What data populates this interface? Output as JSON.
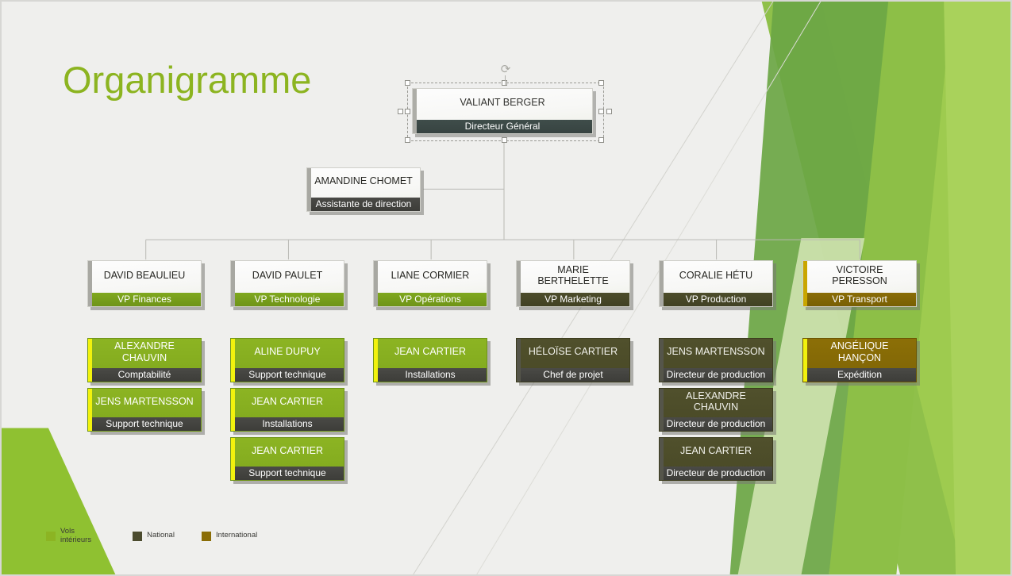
{
  "slide": {
    "title": "Organigramme",
    "title_color": "#8cb420",
    "background_color": "#efefed"
  },
  "chart_data": {
    "type": "diagram",
    "diagram_type": "organization-chart",
    "title": "Organigramme",
    "root": {
      "name": "VALIANT BERGER",
      "role": "Directeur Général",
      "style": "light",
      "selected": true
    },
    "assistant": {
      "name": "AMANDINE CHOMET",
      "role": "Assistante de direction",
      "style": "light"
    },
    "columns": [
      {
        "head": {
          "name": "DAVID BEAULIEU",
          "role": "VP Finances",
          "style": "light",
          "bar": "green",
          "edge": "grey"
        },
        "reports": [
          {
            "name": "ALEXANDRE CHAUVIN",
            "role": "Comptabilité",
            "style": "green",
            "bar": "dark",
            "edge": "yellow"
          },
          {
            "name": "JENS MARTENSSON",
            "role": "Support technique",
            "style": "green",
            "bar": "dark",
            "edge": "yellow"
          }
        ]
      },
      {
        "head": {
          "name": "DAVID PAULET",
          "role": "VP Technologie",
          "style": "light",
          "bar": "green",
          "edge": "grey"
        },
        "reports": [
          {
            "name": "ALINE DUPUY",
            "role": "Support technique",
            "style": "green",
            "bar": "dark",
            "edge": "yellow"
          },
          {
            "name": "JEAN CARTIER",
            "role": "Installations",
            "style": "green",
            "bar": "dark",
            "edge": "yellow"
          },
          {
            "name": "JEAN CARTIER",
            "role": "Support technique",
            "style": "green",
            "bar": "dark",
            "edge": "yellow"
          }
        ]
      },
      {
        "head": {
          "name": "LIANE CORMIER",
          "role": "VP Opérations",
          "style": "light",
          "bar": "green",
          "edge": "grey"
        },
        "reports": [
          {
            "name": "JEAN CARTIER",
            "role": "Installations",
            "style": "green",
            "bar": "dark",
            "edge": "yellow"
          }
        ]
      },
      {
        "head": {
          "name": "MARIE BERTHELETTE",
          "role": "VP Marketing",
          "style": "light",
          "bar": "olive",
          "edge": "grey"
        },
        "reports": [
          {
            "name": "HÉLOÏSE CARTIER",
            "role": "Chef de projet",
            "style": "olive",
            "bar": "dark",
            "edge": "dark"
          }
        ]
      },
      {
        "head": {
          "name": "CORALIE HÉTU",
          "role": "VP Production",
          "style": "light",
          "bar": "olive",
          "edge": "grey"
        },
        "reports": [
          {
            "name": "JENS MARTENSSON",
            "role": "Directeur de  production",
            "style": "olive",
            "bar": "dark",
            "edge": "dark"
          },
          {
            "name": "ALEXANDRE CHAUVIN",
            "role": "Directeur  de production",
            "style": "olive",
            "bar": "dark",
            "edge": "dark"
          },
          {
            "name": "JEAN CARTIER",
            "role": "Directeur  de production",
            "style": "olive",
            "bar": "dark",
            "edge": "dark"
          }
        ]
      },
      {
        "head": {
          "name": "VICTOIRE PERESSON",
          "role": "VP Transport",
          "style": "light",
          "bar": "gold",
          "edge": "gold"
        },
        "reports": [
          {
            "name": "ANGÉLIQUE HANÇON",
            "role": "Expédition",
            "style": "gold",
            "bar": "dark",
            "edge": "yellow"
          }
        ]
      }
    ]
  },
  "legend": {
    "items": [
      {
        "label": "Vols\nintérieurs",
        "color": "#8cb423"
      },
      {
        "label": "National",
        "color": "#4b4b2e"
      },
      {
        "label": "International",
        "color": "#8a6d06"
      }
    ]
  },
  "icons": {
    "rotate": "⟳"
  }
}
